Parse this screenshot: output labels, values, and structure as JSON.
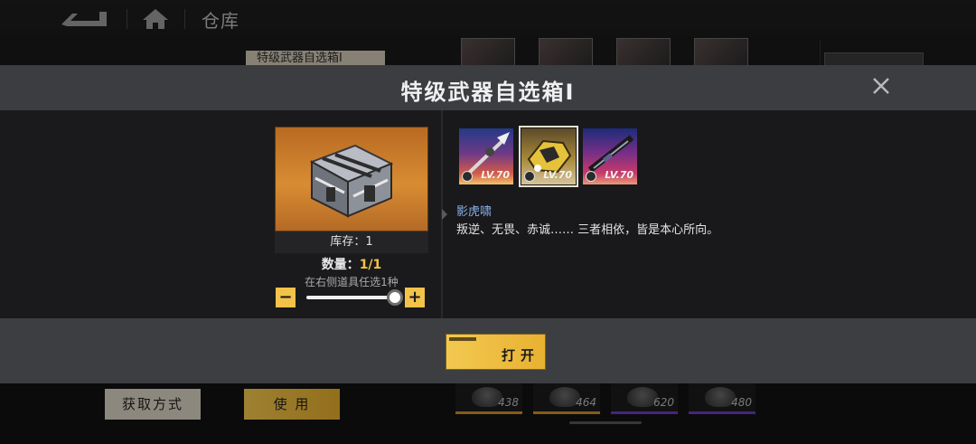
{
  "nav": {
    "title": "仓库",
    "back_icon": "back-arrow-icon",
    "home_icon": "home-icon"
  },
  "background": {
    "tag_label": "特级武器自选箱I",
    "get_method_label": "获取方式",
    "use_label": "使 用",
    "slots": [
      {
        "count": "438",
        "rarity": "gold"
      },
      {
        "count": "464",
        "rarity": "gold"
      },
      {
        "count": "620",
        "rarity": "purple"
      },
      {
        "count": "480",
        "rarity": "purple"
      }
    ]
  },
  "dialog": {
    "title": "特级武器自选箱I",
    "close_icon": "close-icon",
    "item": {
      "stock_label": "库存：1",
      "quantity_label": "数量：",
      "quantity_value": "1/1",
      "hint": "在右侧道具任选1种",
      "minus_label": "−",
      "plus_label": "+",
      "slider_fraction": 1.0
    },
    "weapons": [
      {
        "level": "LV.70",
        "selected": false
      },
      {
        "level": "LV.70",
        "selected": true
      },
      {
        "level": "LV.70",
        "selected": false
      }
    ],
    "selected_name": "影虎啸",
    "selected_desc": "叛逆、无畏、赤诚…… 三者相依，皆是本心所向。",
    "open_label": "打开"
  },
  "colors": {
    "accent": "#f2c24a",
    "name_blue": "#8ab0e8",
    "header": "#3c3d41"
  }
}
